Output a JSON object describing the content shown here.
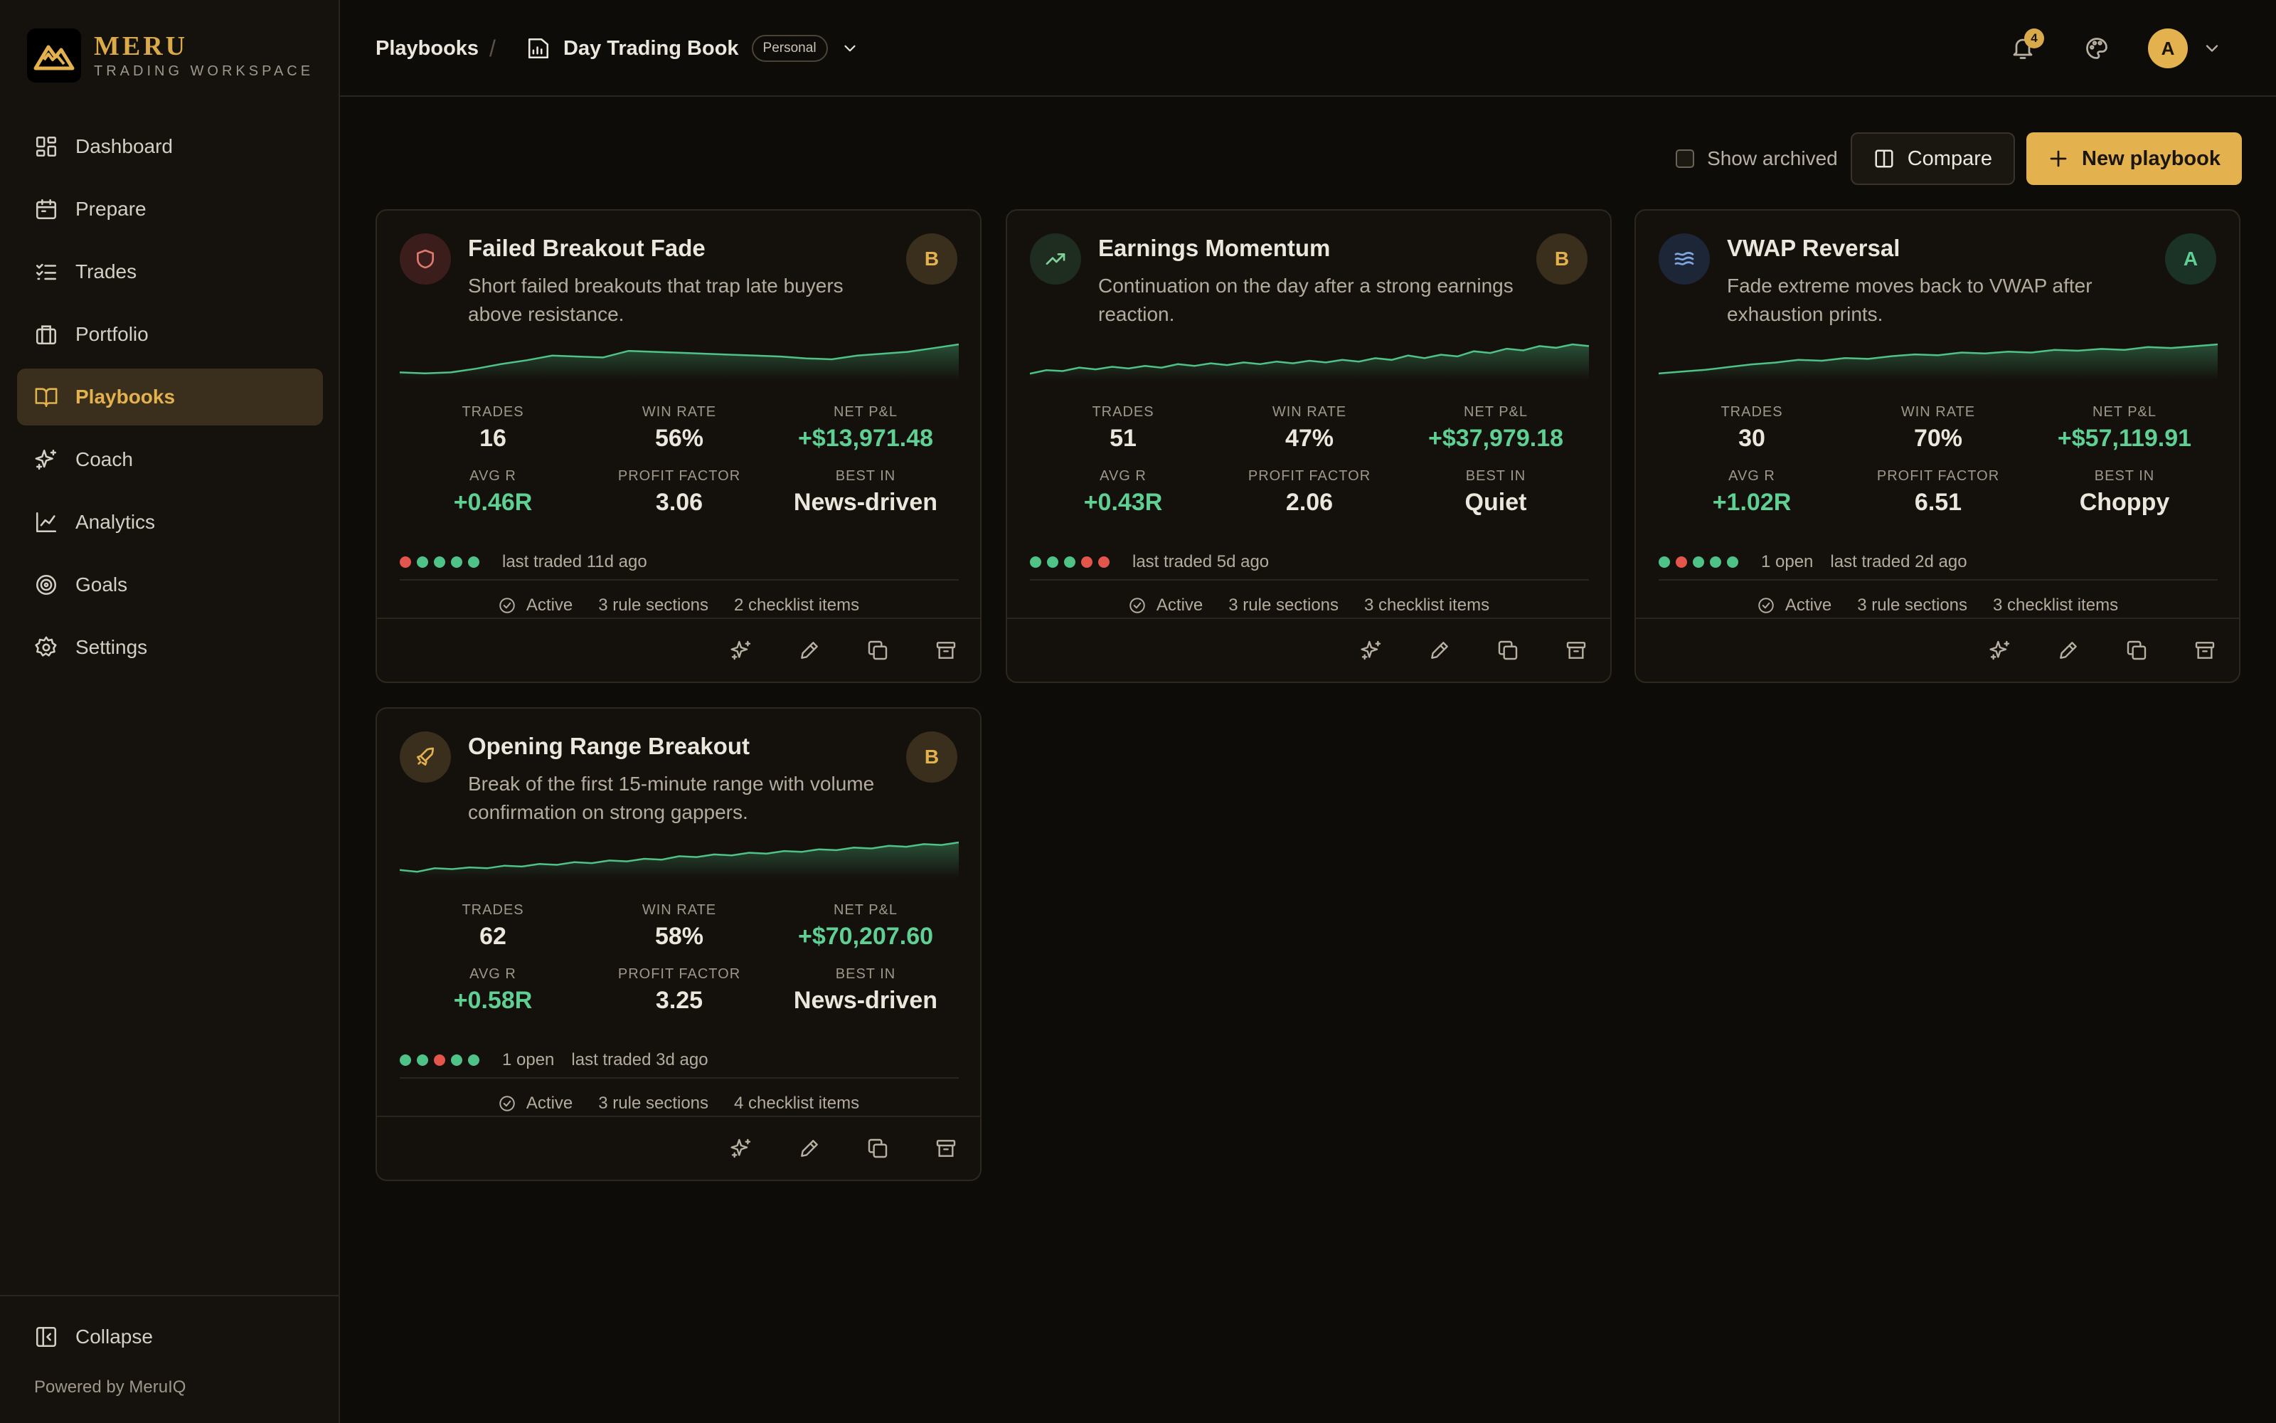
{
  "brand": {
    "name": "MERU",
    "subtitle": "TRADING WORKSPACE"
  },
  "nav": [
    {
      "label": "Dashboard"
    },
    {
      "label": "Prepare"
    },
    {
      "label": "Trades"
    },
    {
      "label": "Portfolio"
    },
    {
      "label": "Playbooks",
      "active": true
    },
    {
      "label": "Coach"
    },
    {
      "label": "Analytics"
    },
    {
      "label": "Goals"
    },
    {
      "label": "Settings"
    }
  ],
  "sidebar_footer": {
    "collapse_label": "Collapse",
    "powered_by": "Powered by MeruIQ"
  },
  "header": {
    "breadcrumb_root": "Playbooks",
    "breadcrumb_sep": "/",
    "book_name": "Day Trading Book",
    "book_badge": "Personal",
    "notification_count": "4",
    "avatar_initial": "A"
  },
  "toolbar": {
    "show_archived_label": "Show archived",
    "compare_label": "Compare",
    "new_playbook_label": "New playbook"
  },
  "stat_labels": {
    "trades": "TRADES",
    "win_rate": "WIN RATE",
    "net_pnl": "NET P&L",
    "avg_r": "AVG R",
    "profit_factor": "PROFIT FACTOR",
    "best_in": "BEST IN"
  },
  "cards": [
    {
      "icon": "shield-icon",
      "title": "Failed Breakout Fade",
      "description": "Short failed breakouts that trap late buyers above resistance.",
      "grade": "B",
      "trades": "16",
      "win_rate": "56%",
      "net_pnl": "+$13,971.48",
      "avg_r": "+0.46R",
      "profit_factor": "3.06",
      "best_in": "News-driven",
      "recent_results": [
        "loss",
        "win",
        "win",
        "win",
        "win"
      ],
      "open_text": "",
      "last_traded": "last traded 11d ago",
      "status": "Active",
      "rule_sections": "3 rule sections",
      "checklist_items": "2 checklist items",
      "equity_curve": [
        6,
        5,
        6,
        10,
        15,
        19,
        24,
        23,
        22,
        29,
        28,
        27,
        26,
        25,
        24,
        23,
        21,
        20,
        24,
        26,
        28,
        32,
        36
      ]
    },
    {
      "icon": "trending-up-icon",
      "title": "Earnings Momentum",
      "description": "Continuation on the day after a strong earnings reaction.",
      "grade": "B",
      "trades": "51",
      "win_rate": "47%",
      "net_pnl": "+$37,979.18",
      "avg_r": "+0.43R",
      "profit_factor": "2.06",
      "best_in": "Quiet",
      "recent_results": [
        "win",
        "win",
        "win",
        "loss",
        "loss"
      ],
      "open_text": "",
      "last_traded": "last traded 5d ago",
      "status": "Active",
      "rule_sections": "3 rule sections",
      "checklist_items": "3 checklist items",
      "equity_curve": [
        4,
        8,
        7,
        11,
        9,
        12,
        10,
        13,
        11,
        15,
        13,
        16,
        14,
        17,
        15,
        18,
        16,
        19,
        17,
        20,
        18,
        22,
        20,
        25,
        22,
        26,
        24,
        30,
        28,
        33,
        31,
        36,
        34,
        38,
        36
      ]
    },
    {
      "icon": "waves-icon",
      "title": "VWAP Reversal",
      "description": "Fade extreme moves back to VWAP after exhaustion prints.",
      "grade": "A",
      "trades": "30",
      "win_rate": "70%",
      "net_pnl": "+$57,119.91",
      "avg_r": "+1.02R",
      "profit_factor": "6.51",
      "best_in": "Choppy",
      "recent_results": [
        "win",
        "loss",
        "win",
        "win",
        "win"
      ],
      "open_text": "1 open",
      "last_traded": "last traded 2d ago",
      "status": "Active",
      "rule_sections": "3 rule sections",
      "checklist_items": "3 checklist items",
      "equity_curve": [
        4,
        6,
        8,
        11,
        14,
        16,
        19,
        18,
        21,
        20,
        23,
        25,
        24,
        27,
        26,
        28,
        27,
        30,
        29,
        31,
        30,
        33,
        32,
        34,
        36
      ]
    },
    {
      "icon": "rocket-icon",
      "title": "Opening Range Breakout",
      "description": "Break of the first 15-minute range with volume confirmation on strong gappers.",
      "grade": "B",
      "trades": "62",
      "win_rate": "58%",
      "net_pnl": "+$70,207.60",
      "avg_r": "+0.58R",
      "profit_factor": "3.25",
      "best_in": "News-driven",
      "recent_results": [
        "win",
        "win",
        "loss",
        "win",
        "win"
      ],
      "open_text": "1 open",
      "last_traded": "last traded 3d ago",
      "status": "Active",
      "rule_sections": "3 rule sections",
      "checklist_items": "4 checklist items",
      "equity_curve": [
        6,
        4,
        8,
        7,
        9,
        8,
        11,
        10,
        13,
        12,
        15,
        14,
        17,
        16,
        19,
        18,
        22,
        21,
        24,
        23,
        26,
        25,
        28,
        27,
        30,
        29,
        32,
        31,
        34,
        33,
        36,
        35,
        38
      ]
    }
  ],
  "colors": {
    "accent": "#e3b24f",
    "positive": "#5fcf93",
    "win_dot": "#4fc387",
    "loss_dot": "#e2564b",
    "background": "#0e0c08"
  }
}
